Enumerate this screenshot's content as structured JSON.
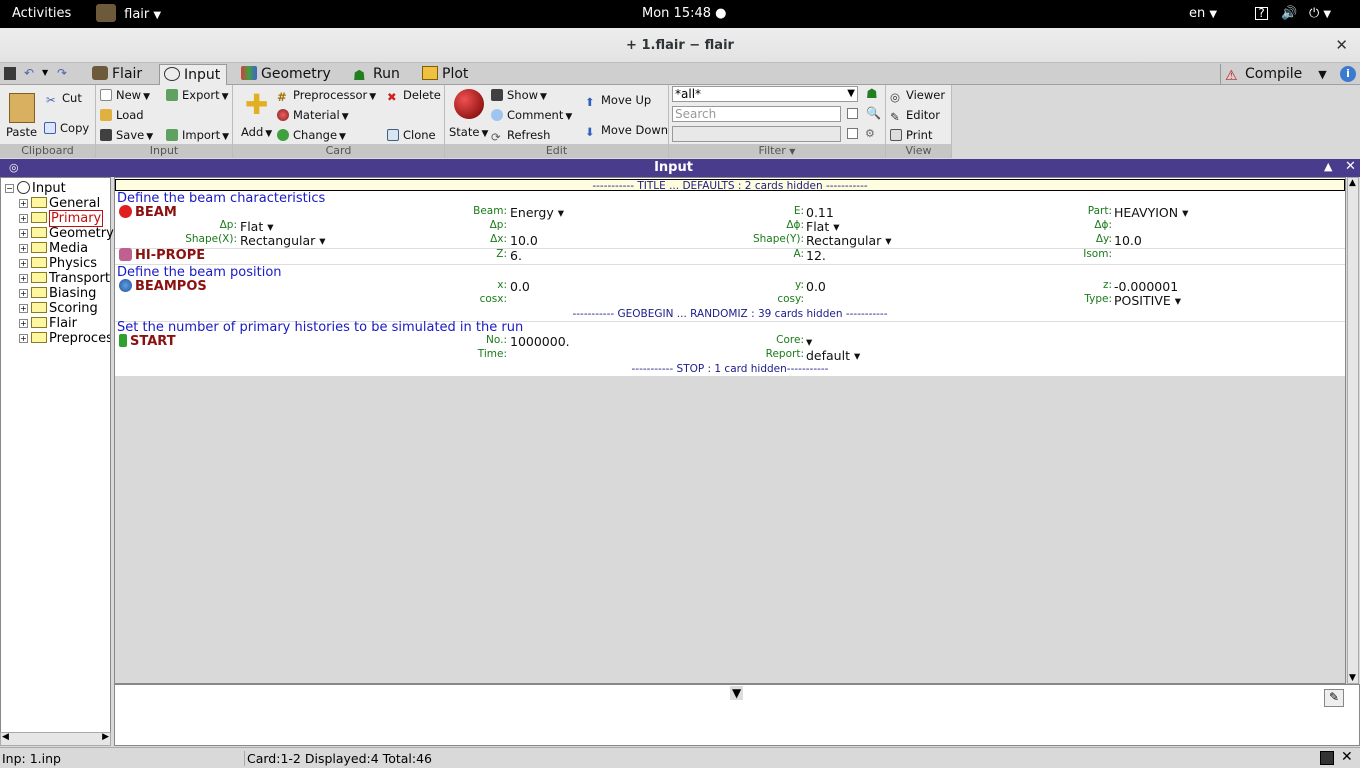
{
  "gnome": {
    "activities": "Activities",
    "app": "flair",
    "clock": "Mon 15:48",
    "lang": "en"
  },
  "window": {
    "title": "+ 1.flair − flair"
  },
  "tabs": [
    "Flair",
    "Input",
    "Geometry",
    "Run",
    "Plot"
  ],
  "compile": "Compile",
  "ribbon": {
    "clipboard": {
      "paste": "Paste",
      "cut": "Cut",
      "copy": "Copy",
      "label": "Clipboard"
    },
    "input": {
      "new": "New",
      "load": "Load",
      "save": "Save",
      "export": "Export",
      "import": "Import",
      "label": "Input"
    },
    "card": {
      "add": "Add",
      "preprocessor": "Preprocessor",
      "material": "Material",
      "change": "Change",
      "delete": "Delete",
      "clone": "Clone",
      "label": "Card"
    },
    "edit": {
      "state": "State",
      "show": "Show",
      "comment": "Comment",
      "refresh": "Refresh",
      "move_up": "Move Up",
      "move_down": "Move Down",
      "label": "Edit"
    },
    "filter": {
      "value": "*all*",
      "search_placeholder": "Search",
      "label": "Filter"
    },
    "view": {
      "viewer": "Viewer",
      "editor": "Editor",
      "print": "Print",
      "label": "View"
    }
  },
  "input_header": "Input",
  "tree": {
    "root": "Input",
    "items": [
      "General",
      "Primary",
      "Geometry",
      "Media",
      "Physics",
      "Transport",
      "Biasing",
      "Scoring",
      "Flair",
      "Preprocessor"
    ]
  },
  "cards": {
    "hidden1": "----------- TITLE ... DEFAULTS : 2 cards hidden -----------",
    "beam": {
      "comment": "Define the beam characteristics",
      "name": "BEAM",
      "beam_lbl": "Beam:",
      "beam_val": "Energy ▾",
      "e_lbl": "E:",
      "e_val": "0.11",
      "part_lbl": "Part:",
      "part_val": "HEAVYION ▾",
      "dp_lbl": "Δp:",
      "dp_val": "Flat ▾",
      "dp2_lbl": "Δp:",
      "dphi_lbl": "Δϕ:",
      "dphi_val": "Flat ▾",
      "dphi2_lbl": "Δϕ:",
      "shapex_lbl": "Shape(X):",
      "shapex_val": "Rectangular ▾",
      "dx_lbl": "Δx:",
      "dx_val": "10.0",
      "shapey_lbl": "Shape(Y):",
      "shapey_val": "Rectangular ▾",
      "dy_lbl": "Δy:",
      "dy_val": "10.0"
    },
    "hiprope": {
      "name": "HI-PROPE",
      "z_lbl": "Z:",
      "z_val": "6.",
      "a_lbl": "A:",
      "a_val": "12.",
      "isom_lbl": "Isom:"
    },
    "beampos": {
      "comment": "Define the beam position",
      "name": "BEAMPOS",
      "x_lbl": "x:",
      "x_val": "0.0",
      "y_lbl": "y:",
      "y_val": "0.0",
      "z_lbl": "z:",
      "z_val": "-0.000001",
      "cosx_lbl": "cosx:",
      "cosy_lbl": "cosy:",
      "type_lbl": "Type:",
      "type_val": "POSITIVE ▾"
    },
    "hidden2": "----------- GEOBEGIN ... RANDOMIZ : 39 cards hidden -----------",
    "start": {
      "comment": "Set the number of primary histories to be simulated in the run",
      "name": "START",
      "no_lbl": "No.:",
      "no_val": "1000000.",
      "core_lbl": "Core:",
      "core_val": "▾",
      "time_lbl": "Time:",
      "report_lbl": "Report:",
      "report_val": "default ▾"
    },
    "hidden3": "----------- STOP : 1 card hidden-----------"
  },
  "status": {
    "inp": "Inp: 1.inp",
    "info": "Card:1-2   Displayed:4  Total:46"
  },
  "colors": {
    "header_bg": "#4a3c8c",
    "card_name": "#8b1010",
    "comment": "#1a1ac6",
    "field_label": "#1a7a1a"
  }
}
